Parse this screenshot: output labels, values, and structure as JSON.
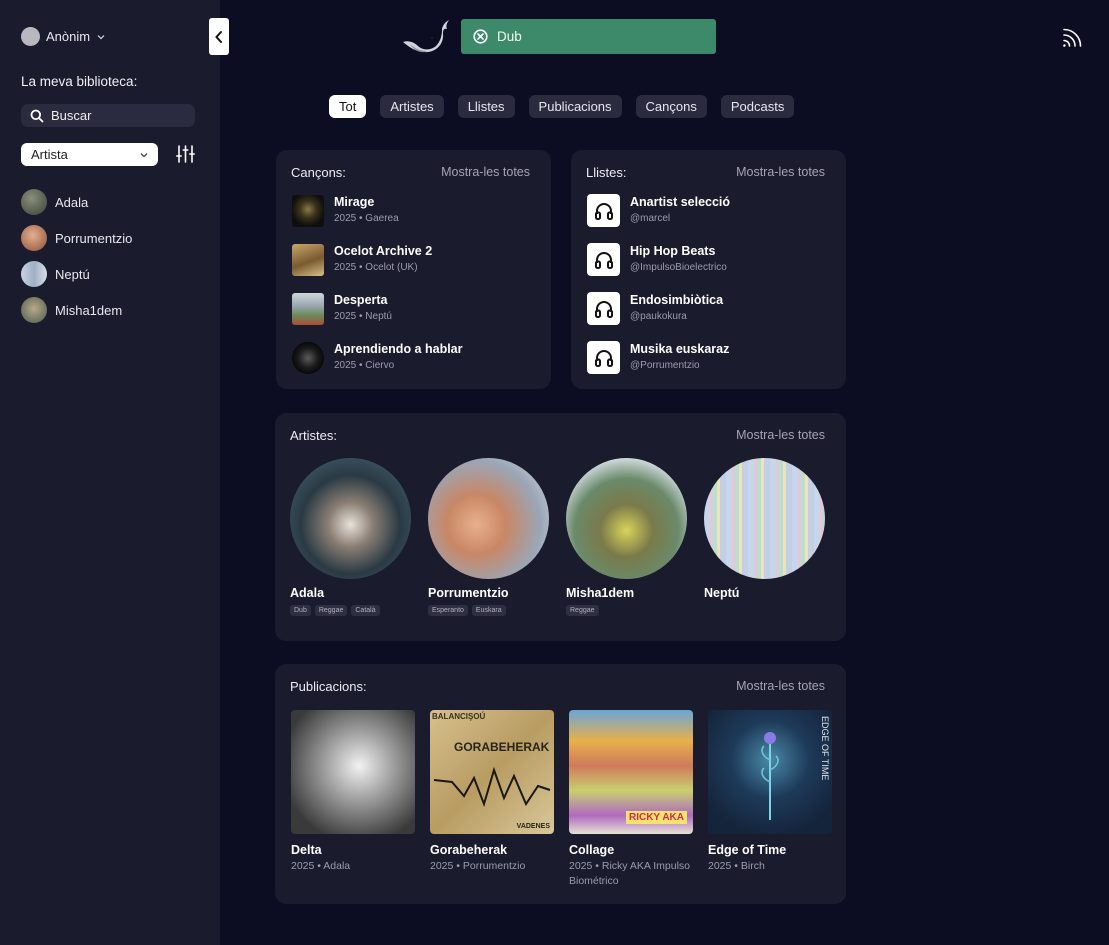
{
  "sidebar": {
    "user_name": "Anònim",
    "library_title": "La meva biblioteca:",
    "search_label": "Buscar",
    "filter_value": "Artista",
    "artists": [
      {
        "name": "Adala",
        "color": "#5b6a5a"
      },
      {
        "name": "Porrumentzio",
        "color": "#b8735a"
      },
      {
        "name": "Neptú",
        "color": "#a9b6c6"
      },
      {
        "name": "Misha1dem",
        "color": "#6b7c6a"
      }
    ]
  },
  "header": {
    "search_value": "Dub",
    "search_color": "#3c8a6a"
  },
  "tabs": [
    "Tot",
    "Artistes",
    "Llistes",
    "Publicacions",
    "Cançons",
    "Podcasts"
  ],
  "songs": {
    "title": "Cançons:",
    "more": "Mostra-les totes",
    "items": [
      {
        "title": "Mirage",
        "sub": "2025 • Gaerea"
      },
      {
        "title": "Ocelot Archive 2",
        "sub": "2025 • Ocelot (UK)"
      },
      {
        "title": "Desperta",
        "sub": "2025 • Neptú"
      },
      {
        "title": "Aprendiendo a hablar",
        "sub": "2025 • Ciervo"
      }
    ]
  },
  "playlists": {
    "title": "Llistes:",
    "more": "Mostra-les totes",
    "items": [
      {
        "title": "Anartist selecció",
        "sub": "@marcel"
      },
      {
        "title": "Hip Hop Beats",
        "sub": "@ImpulsoBioelectrico"
      },
      {
        "title": "Endosimbiòtica",
        "sub": "@paukokura"
      },
      {
        "title": "Musika euskaraz",
        "sub": "@Porrumentzio"
      }
    ]
  },
  "artists": {
    "title": "Artistes:",
    "more": "Mostra-les totes",
    "items": [
      {
        "name": "Adala",
        "tags": [
          "Dub",
          "Reggae",
          "Català"
        ]
      },
      {
        "name": "Porrumentzio",
        "tags": [
          "Esperanto",
          "Euskara"
        ]
      },
      {
        "name": "Misha1dem",
        "tags": [
          "Reggae"
        ]
      },
      {
        "name": "Neptú",
        "tags": []
      }
    ]
  },
  "publications": {
    "title": "Publicacions:",
    "more": "Mostra-les totes",
    "items": [
      {
        "title": "Delta",
        "sub": "2025 • Adala"
      },
      {
        "title": "Gorabeherak",
        "sub": "2025 • Porrumentzio",
        "cover_text_top": "BALANCIŞOÚ",
        "cover_text_main": "GORABEHERAK",
        "cover_text_bottom": "VADENES"
      },
      {
        "title": "Collage",
        "sub": "2025 • Ricky AKA Impulso Biométrico",
        "cover_text": "RICKY AKA"
      },
      {
        "title": "Edge of Time",
        "sub": "2025 • Birch",
        "cover_text": "EDGE OF TIME"
      }
    ]
  }
}
